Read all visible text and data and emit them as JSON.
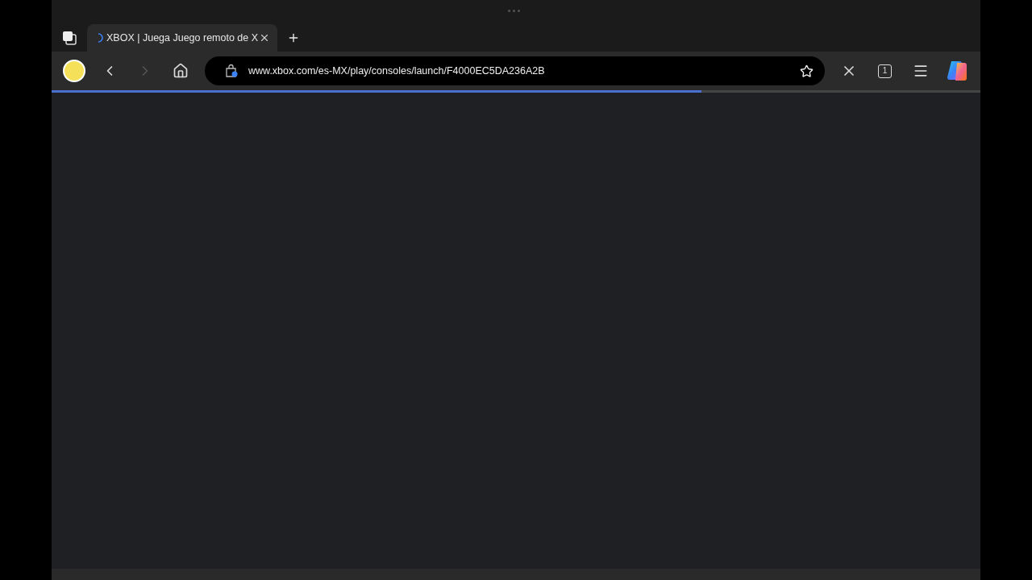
{
  "tabs": [
    {
      "title": "XBOX | Juega Juego remoto de X",
      "selected": true,
      "loading": true
    }
  ],
  "toolbar": {
    "back_disabled": false,
    "forward_disabled": true,
    "url": "www.xbox.com/es-MX/play/consoles/launch/F4000EC5DA236A2B",
    "tab_count": "1"
  },
  "page_load": {
    "level": 0.7
  }
}
